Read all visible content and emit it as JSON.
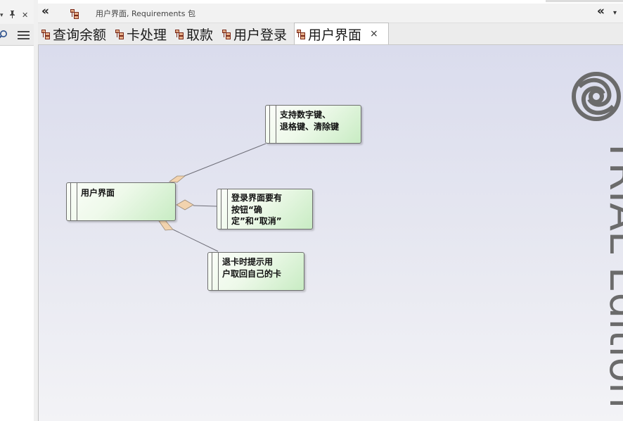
{
  "left_panel": {
    "pin_icon": "📌",
    "close_icon": "✕",
    "search_icon": "🔍",
    "menu_icon": "≡"
  },
  "titlebar": {
    "back_icon": "«",
    "title": "用户界面,  Requirements 包",
    "collapse_icon": "«"
  },
  "tabs": [
    {
      "label": "查询余额",
      "active": false
    },
    {
      "label": "卡处理",
      "active": false
    },
    {
      "label": "取款",
      "active": false
    },
    {
      "label": "用户登录",
      "active": false
    },
    {
      "label": "用户界面",
      "active": true,
      "close": "×"
    }
  ],
  "diagram": {
    "elements": [
      {
        "id": "ui",
        "text": "用户界面"
      },
      {
        "id": "keys",
        "text": "支持数字键、\n退格键、清除键"
      },
      {
        "id": "login",
        "text": "登录界面要有\n按钮“确\n定”和“取消”"
      },
      {
        "id": "eject",
        "text": "退卡时提示用\n户取回自己的卡"
      }
    ],
    "connector_color": "#6e6e78",
    "diamond_color": "#f2d3ae"
  },
  "watermark": {
    "text": "TRIAL Edition",
    "color": "#6b6b6b"
  }
}
